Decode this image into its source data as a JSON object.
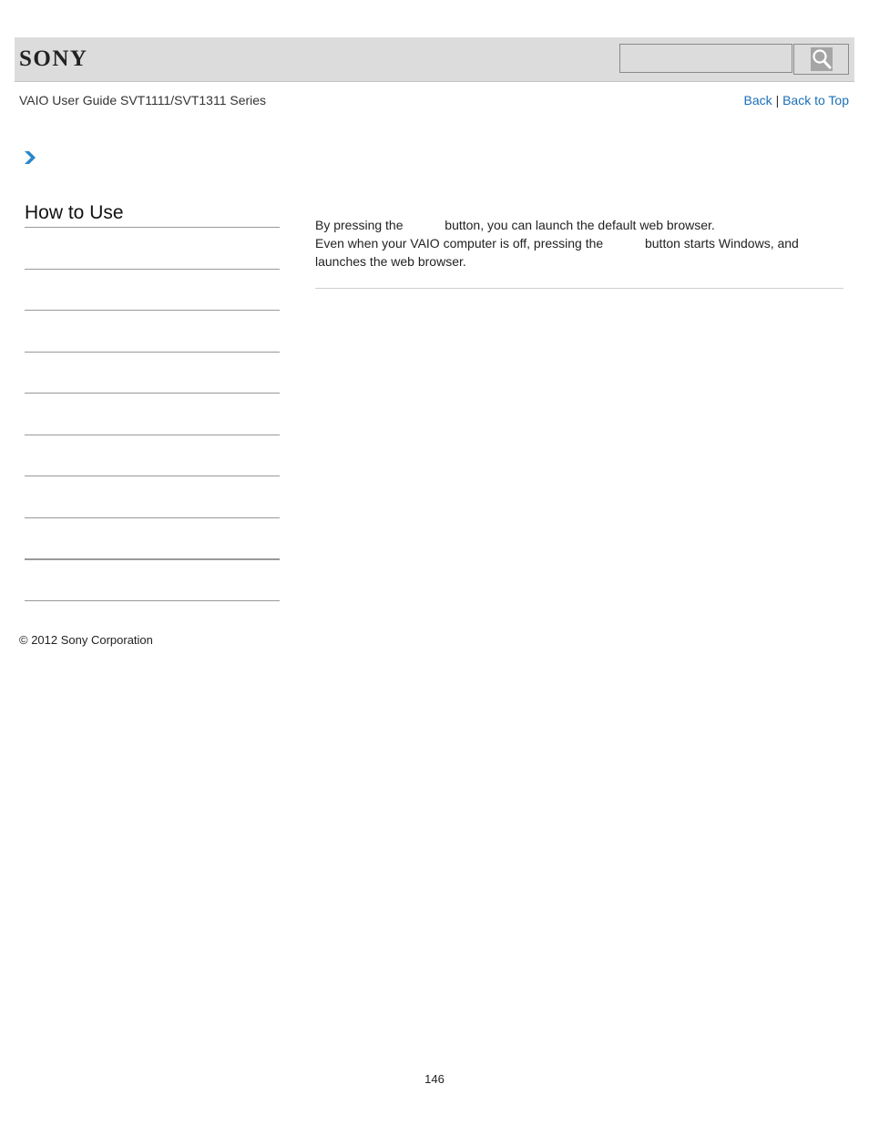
{
  "header": {
    "logo": "SONY",
    "search_placeholder": "",
    "search_icon": "search-icon"
  },
  "subheader": {
    "guide_title": "VAIO User Guide SVT1111/SVT1311 Series",
    "back_label": "Back",
    "separator": "|",
    "back_to_top_label": "Back to Top"
  },
  "breadcrumb": {
    "icon": "chevron-right-icon",
    "accent_color": "#2a86c8"
  },
  "sidebar": {
    "title": "How to Use",
    "items": [
      "",
      "",
      "",
      "",
      "",
      "",
      "",
      "",
      ""
    ]
  },
  "content": {
    "line1_a": "By pressing the",
    "line1_b": "button, you can launch the default web browser.",
    "line2_a": "Even when your VAIO computer is off, pressing the",
    "line2_b": "button starts Windows, and",
    "line3": "launches the web browser."
  },
  "footer": {
    "copyright": "© 2012 Sony Corporation",
    "page_number": "146"
  }
}
